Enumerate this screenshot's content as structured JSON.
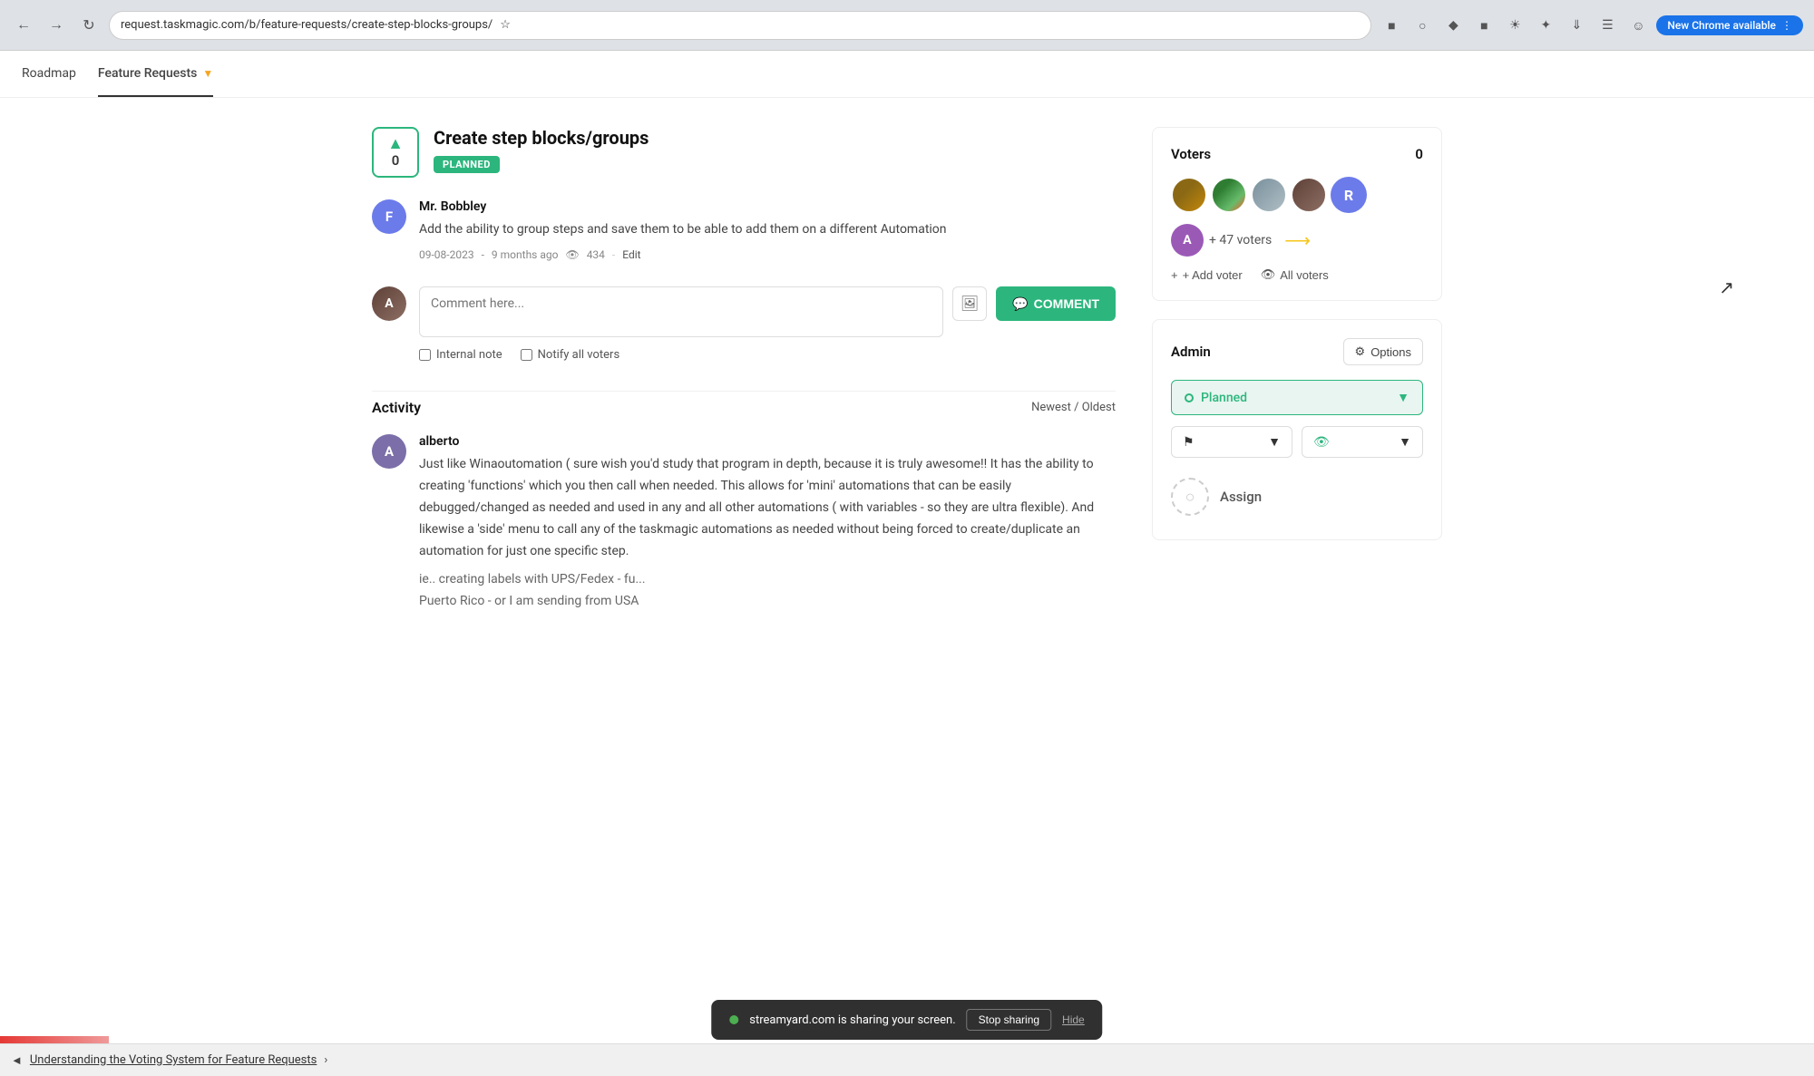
{
  "browser": {
    "url": "request.taskmagic.com/b/feature-requests/create-step-blocks-groups/",
    "new_chrome_label": "New Chrome available"
  },
  "nav": {
    "items": [
      {
        "label": "Roadmap",
        "active": false
      },
      {
        "label": "Feature Requests",
        "active": true,
        "has_dropdown": true
      }
    ]
  },
  "feature": {
    "vote_count": "0",
    "title": "Create step blocks/groups",
    "status": "PLANNED",
    "author": "Mr. Bobbley",
    "author_initial": "F",
    "text": "Add the ability to group steps and save them to be able to add them on a different Automation",
    "date": "09-08-2023",
    "time_ago": "9 months ago",
    "views": "434",
    "edit_label": "Edit"
  },
  "comment": {
    "placeholder": "Comment here...",
    "button_label": "COMMENT",
    "internal_note_label": "Internal note",
    "notify_voters_label": "Notify all voters"
  },
  "activity": {
    "title": "Activity",
    "sort_label": "Newest / Oldest",
    "author": "alberto",
    "author_initial": "A",
    "text": "Just like Winaoutomation ( sure wish you'd study that program in depth, because it is truly awesome!! It has the ability to creating 'functions' which you then call when needed. This allows for 'mini' automations that can be easily debugged/changed as needed and used in any and all other automations ( with variables - so they are ultra flexible). And likewise a 'side' menu to call any of the taskmagic automations as needed without being forced to create/duplicate an automation for just one specific step.",
    "text2": "ie.. creating labels with UPS/Fedex - fu...",
    "text3": "Puerto Rico - or I am sending from USA"
  },
  "bottom_ticker": {
    "arrow": "◄",
    "text": "Understanding the Voting System for Feature Requests",
    "chevron": "›"
  },
  "sidebar": {
    "voters_section": {
      "title": "Voters",
      "count": "0",
      "more_count": "+ 47 voters",
      "add_voter_label": "+ Add voter",
      "all_voters_label": "All voters"
    },
    "admin_section": {
      "title": "Admin",
      "options_label": "Options",
      "status_label": "Planned",
      "assign_label": "Assign"
    }
  },
  "screen_share": {
    "text": "streamyard.com is sharing your screen.",
    "stop_label": "Stop sharing",
    "hide_label": "Hide"
  }
}
